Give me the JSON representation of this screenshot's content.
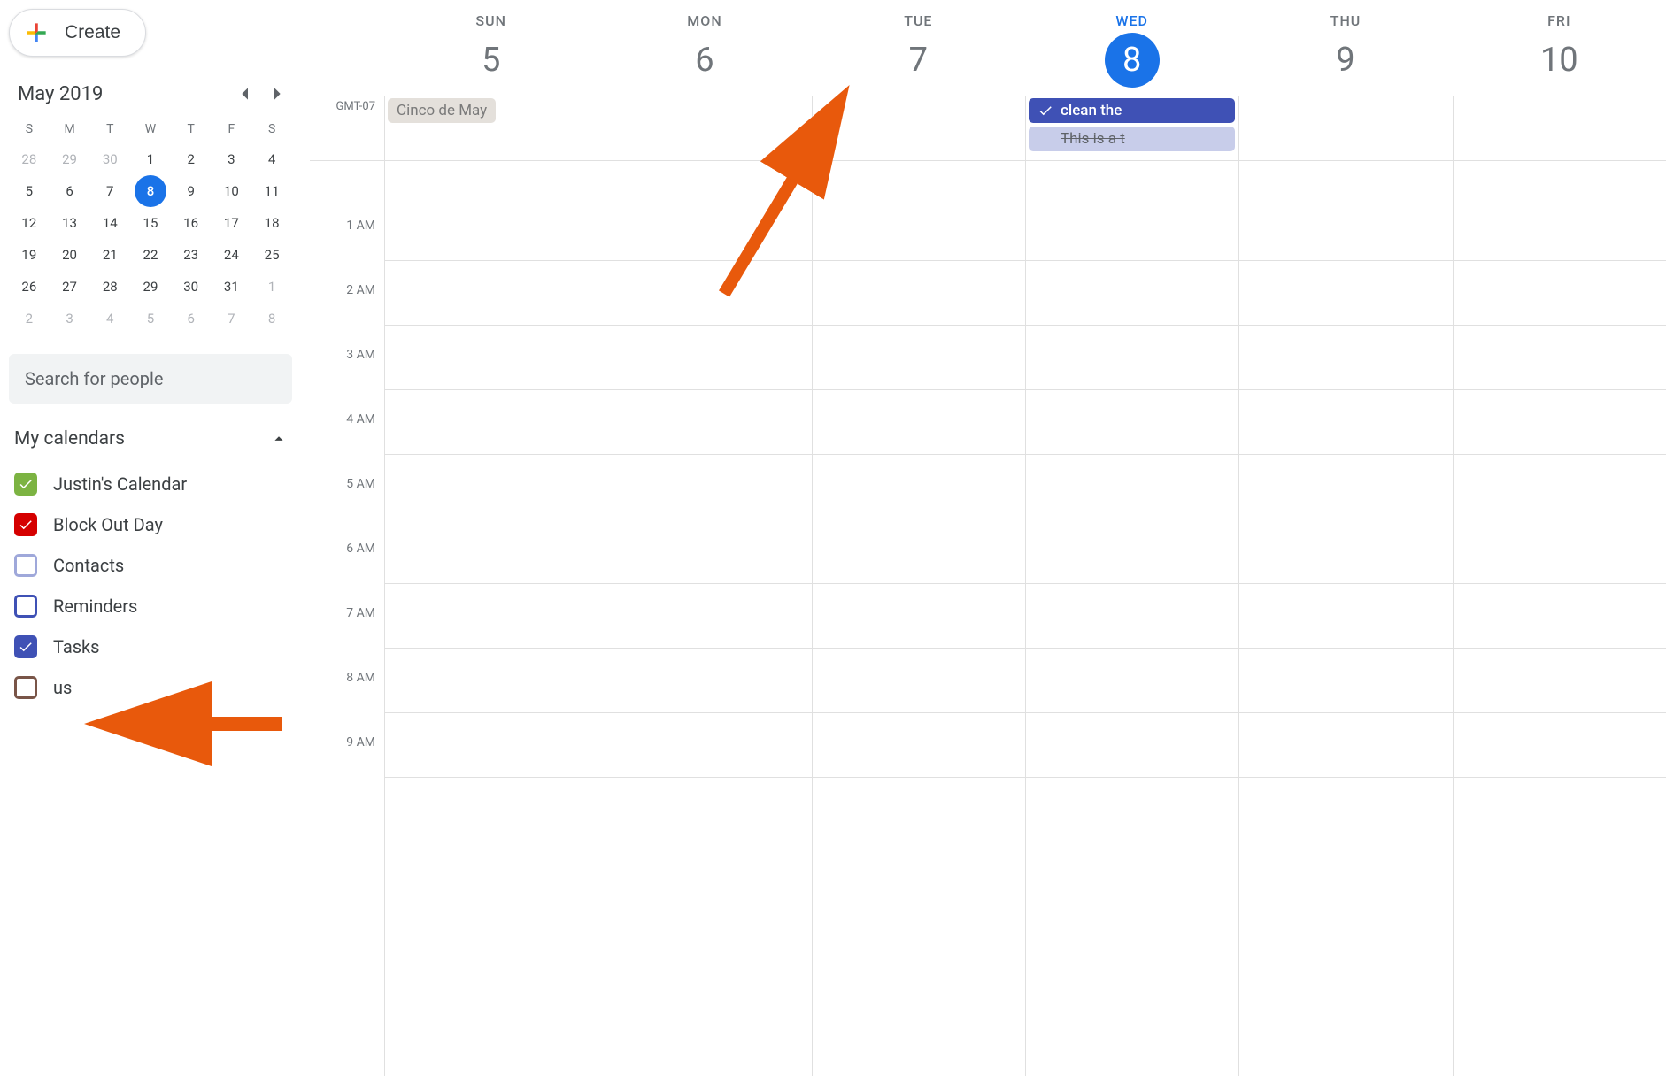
{
  "create_label": "Create",
  "minicalendar": {
    "title": "May 2019",
    "dow": [
      "S",
      "M",
      "T",
      "W",
      "T",
      "F",
      "S"
    ],
    "weeks": [
      [
        {
          "d": 28,
          "other": true
        },
        {
          "d": 29,
          "other": true
        },
        {
          "d": 30,
          "other": true
        },
        {
          "d": 1
        },
        {
          "d": 2
        },
        {
          "d": 3
        },
        {
          "d": 4
        }
      ],
      [
        {
          "d": 5
        },
        {
          "d": 6
        },
        {
          "d": 7
        },
        {
          "d": 8,
          "today": true
        },
        {
          "d": 9
        },
        {
          "d": 10
        },
        {
          "d": 11
        }
      ],
      [
        {
          "d": 12
        },
        {
          "d": 13
        },
        {
          "d": 14
        },
        {
          "d": 15
        },
        {
          "d": 16
        },
        {
          "d": 17
        },
        {
          "d": 18
        }
      ],
      [
        {
          "d": 19
        },
        {
          "d": 20
        },
        {
          "d": 21
        },
        {
          "d": 22
        },
        {
          "d": 23
        },
        {
          "d": 24
        },
        {
          "d": 25
        }
      ],
      [
        {
          "d": 26
        },
        {
          "d": 27
        },
        {
          "d": 28
        },
        {
          "d": 29
        },
        {
          "d": 30
        },
        {
          "d": 31
        },
        {
          "d": 1,
          "other": true
        }
      ],
      [
        {
          "d": 2,
          "other": true
        },
        {
          "d": 3,
          "other": true
        },
        {
          "d": 4,
          "other": true
        },
        {
          "d": 5,
          "other": true
        },
        {
          "d": 6,
          "other": true
        },
        {
          "d": 7,
          "other": true
        },
        {
          "d": 8,
          "other": true
        }
      ]
    ]
  },
  "search_placeholder": "Search for people",
  "my_calendars_label": "My calendars",
  "calendars": [
    {
      "name": "Justin's Calendar",
      "color": "#7cb342",
      "checked": true
    },
    {
      "name": "Block Out Day",
      "color": "#d50000",
      "checked": true
    },
    {
      "name": "Contacts",
      "color": "#9fa8da",
      "checked": false
    },
    {
      "name": "Reminders",
      "color": "#3f51b5",
      "checked": false
    },
    {
      "name": "Tasks",
      "color": "#3f51b5",
      "checked": true
    },
    {
      "name": "us",
      "color": "#795548",
      "checked": false
    }
  ],
  "timezone_label": "GMT-07",
  "days": [
    {
      "dow": "SUN",
      "num": "5"
    },
    {
      "dow": "MON",
      "num": "6"
    },
    {
      "dow": "TUE",
      "num": "7"
    },
    {
      "dow": "WED",
      "num": "8",
      "today": true
    },
    {
      "dow": "THU",
      "num": "9"
    },
    {
      "dow": "FRI",
      "num": "10"
    }
  ],
  "allday_events": {
    "sun": {
      "label": "Cinco de May",
      "type": "muted"
    },
    "wed": [
      {
        "label": "clean the",
        "type": "task"
      },
      {
        "label": "This is a t",
        "type": "ghost"
      }
    ]
  },
  "hours": [
    "",
    "1 AM",
    "2 AM",
    "3 AM",
    "4 AM",
    "5 AM",
    "6 AM",
    "7 AM",
    "8 AM",
    "9 AM"
  ]
}
